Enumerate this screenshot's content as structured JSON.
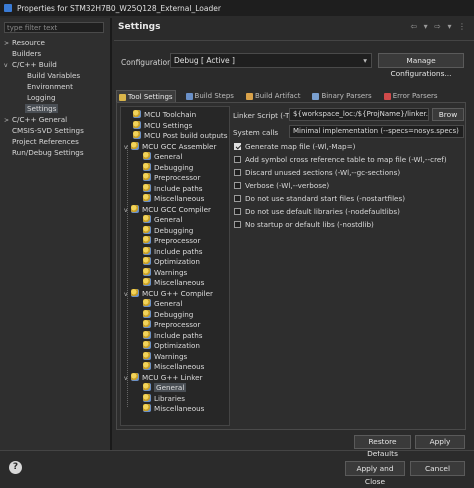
{
  "window": {
    "title": "Properties for STM32H7B0_W25Q128_External_Loader"
  },
  "left": {
    "filter_placeholder": "type filter text",
    "items": [
      {
        "label": "Resource",
        "expandable": true
      },
      {
        "label": "Builders"
      },
      {
        "label": "C/C++ Build",
        "expanded": true
      },
      {
        "label": "Build Variables"
      },
      {
        "label": "Environment"
      },
      {
        "label": "Logging"
      },
      {
        "label": "Settings",
        "selected": true
      },
      {
        "label": "C/C++ General",
        "expandable": true
      },
      {
        "label": "CMSIS-SVD Settings"
      },
      {
        "label": "Project References"
      },
      {
        "label": "Run/Debug Settings"
      }
    ]
  },
  "header": {
    "title": "Settings",
    "nav_glyphs": "⇦ ▾ ⇨ ▾ ⋮"
  },
  "configuration": {
    "label": "Configuration:",
    "value": "Debug  [ Active ]",
    "manage_button": "Manage Configurations..."
  },
  "tabs": [
    {
      "label": "Tool Settings",
      "active": true,
      "icon_color": "#d9b54a"
    },
    {
      "label": "Build Steps",
      "icon_color": "#6a90c8"
    },
    {
      "label": "Build Artifact",
      "icon_color": "#d9a24a"
    },
    {
      "label": "Binary Parsers",
      "icon_color": "#7aa0d0"
    },
    {
      "label": "Error Parsers",
      "icon_color": "#d04a4a"
    }
  ],
  "tool_tree": [
    {
      "label": "MCU Toolchain"
    },
    {
      "label": "MCU Settings"
    },
    {
      "label": "MCU Post build outputs"
    },
    {
      "label": "MCU GCC Assembler",
      "group": true
    },
    {
      "label": "General"
    },
    {
      "label": "Debugging"
    },
    {
      "label": "Preprocessor"
    },
    {
      "label": "Include paths"
    },
    {
      "label": "Miscellaneous"
    },
    {
      "label": "MCU GCC Compiler",
      "group": true
    },
    {
      "label": "General"
    },
    {
      "label": "Debugging"
    },
    {
      "label": "Preprocessor"
    },
    {
      "label": "Include paths"
    },
    {
      "label": "Optimization"
    },
    {
      "label": "Warnings"
    },
    {
      "label": "Miscellaneous"
    },
    {
      "label": "MCU G++ Compiler",
      "group": true
    },
    {
      "label": "General"
    },
    {
      "label": "Debugging"
    },
    {
      "label": "Preprocessor"
    },
    {
      "label": "Include paths"
    },
    {
      "label": "Optimization"
    },
    {
      "label": "Warnings"
    },
    {
      "label": "Miscellaneous"
    },
    {
      "label": "MCU G++ Linker",
      "group": true
    },
    {
      "label": "General",
      "selected": true
    },
    {
      "label": "Libraries"
    },
    {
      "label": "Miscellaneous"
    }
  ],
  "linker": {
    "script_label": "Linker Script (-T)",
    "script_value": "${workspace_loc:/${ProjName}/linker.ld}",
    "browse_button": "Brow",
    "syscalls_label": "System calls",
    "syscalls_value": "Minimal implementation (--specs=nosys.specs)",
    "options": [
      {
        "label": "Generate map file (-Wl,-Map=)",
        "checked": true
      },
      {
        "label": "Add symbol cross reference table to map file (-Wl,--cref)",
        "checked": false
      },
      {
        "label": "Discard unused sections (-Wl,--gc-sections)",
        "checked": false
      },
      {
        "label": "Verbose (-Wl,--verbose)",
        "checked": false
      },
      {
        "label": "Do not use standard start files (-nostartfiles)",
        "checked": false
      },
      {
        "label": "Do not use default libraries (-nodefaultlibs)",
        "checked": false
      },
      {
        "label": "No startup or default libs (-nostdlib)",
        "checked": false
      }
    ]
  },
  "buttons": {
    "restore_defaults": "Restore Defaults",
    "apply": "Apply",
    "apply_close": "Apply and Close",
    "cancel": "Cancel",
    "help": "?"
  }
}
